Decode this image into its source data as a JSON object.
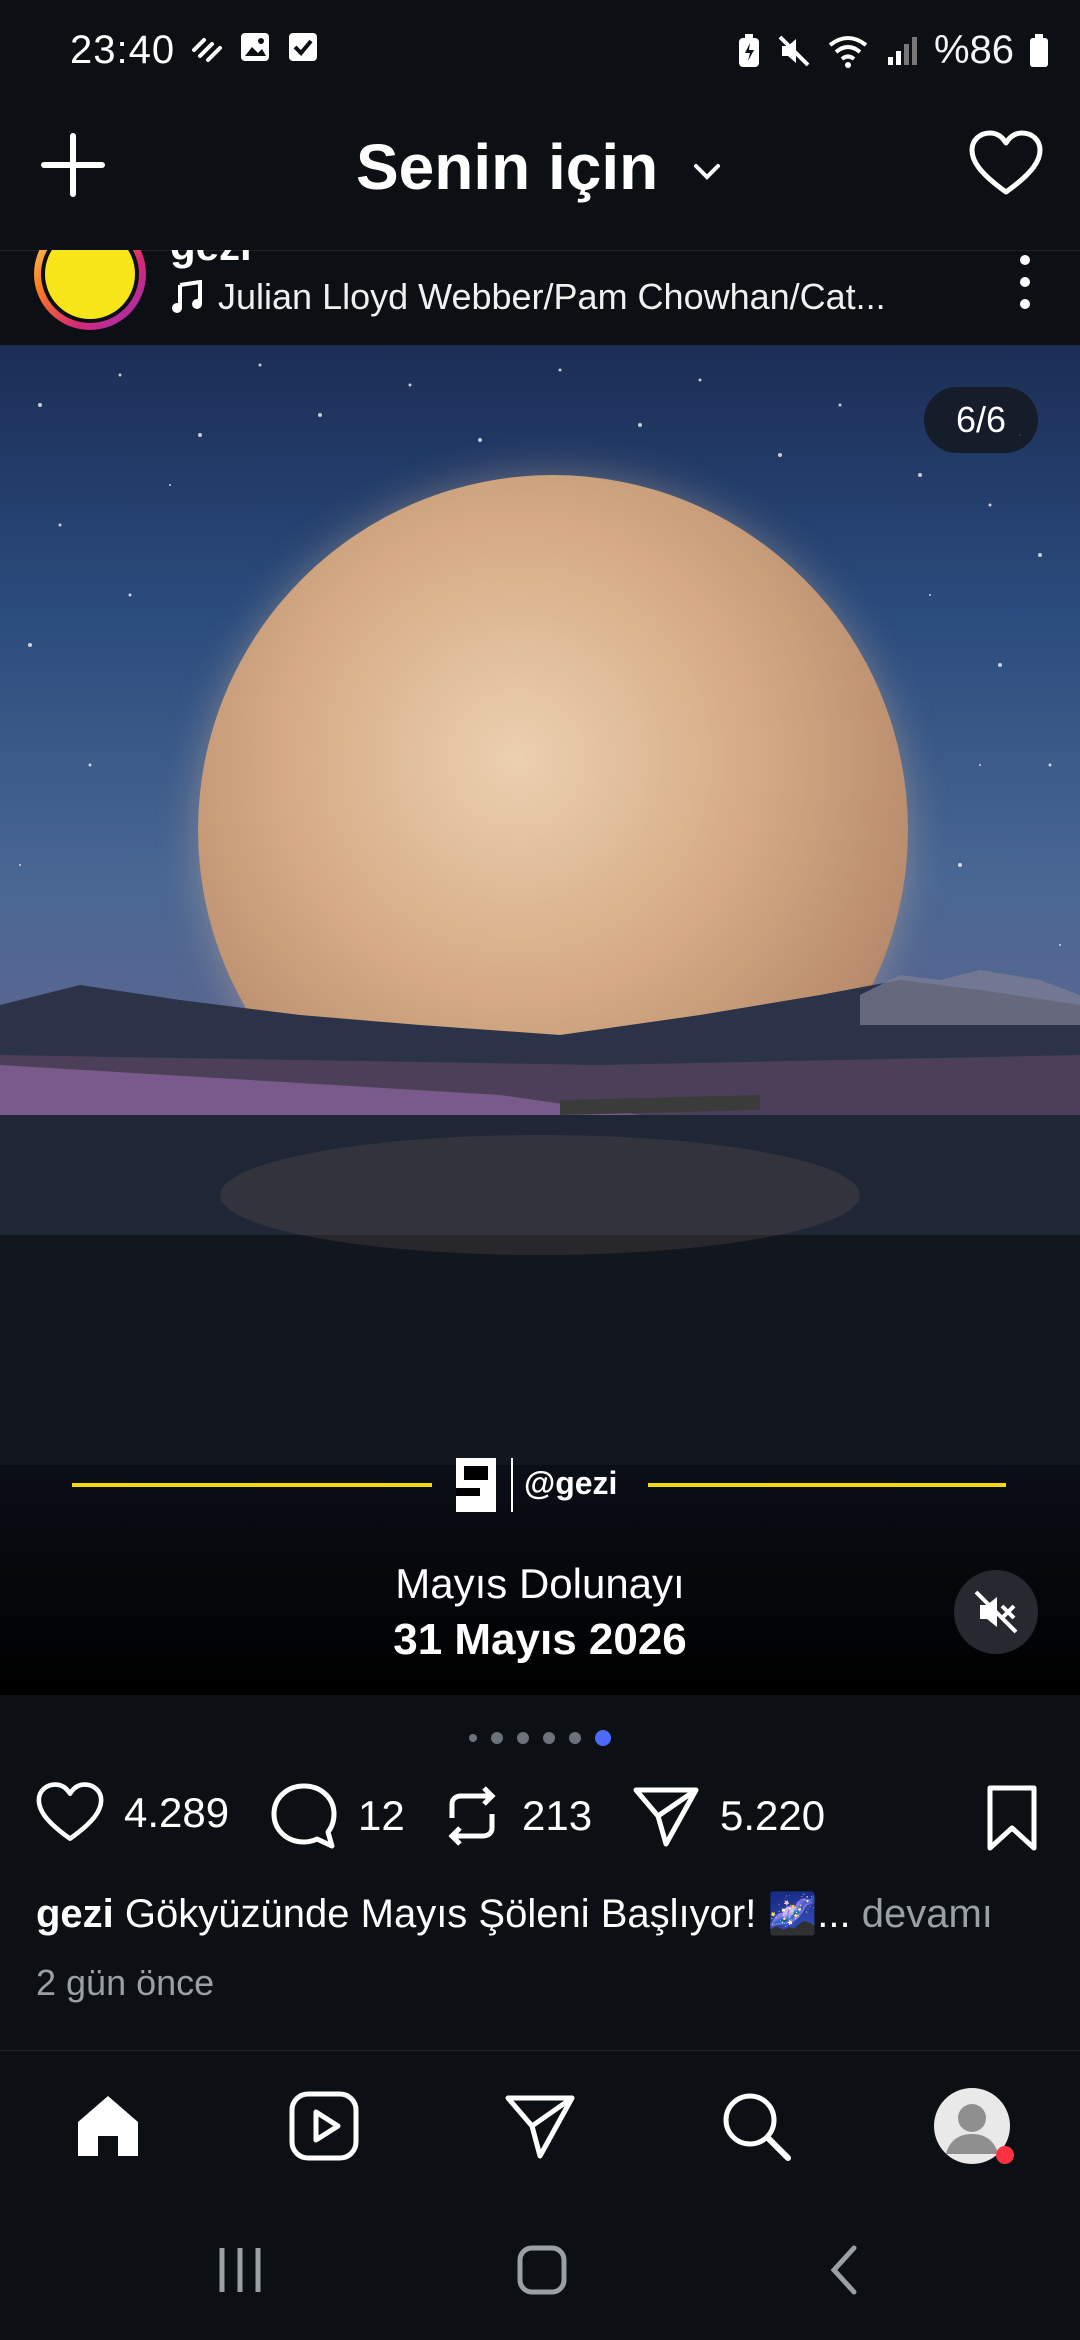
{
  "status_bar": {
    "time": "23:40",
    "battery": "%86",
    "left_icons": [
      "signal-dots-icon",
      "gallery-icon",
      "checkbox-icon"
    ],
    "right_icons": [
      "battery-saver-icon",
      "mute-icon",
      "wifi-icon",
      "cell-signal-icon",
      "battery-icon"
    ]
  },
  "header": {
    "title": "Senin için",
    "icons": [
      "plus-icon",
      "chevron-down-icon",
      "heart-icon"
    ]
  },
  "post": {
    "username": "gezi",
    "verified": true,
    "music": "Julian Lloyd Webber/Pam Chowhan/Cat...",
    "image_counter": "6/6",
    "brand_handle": "@gezi",
    "image_caption_line1": "Mayıs Dolunayı",
    "image_caption_line2": "31 Mayıs 2026",
    "carousel_dots": 6,
    "carousel_active_index": 5,
    "likes": "4.289",
    "comments": "12",
    "reposts": "213",
    "shares": "5.220",
    "caption_text": "Gökyüzünde Mayıs Şöleni Başlıyor! 🌌...",
    "more_label": "devamı",
    "time_ago": "2 gün önce"
  },
  "bottom_nav": {
    "items": [
      "home-icon",
      "reels-icon",
      "send-icon",
      "search-icon",
      "profile-avatar"
    ]
  },
  "colors": {
    "background": "#0c1014",
    "accent_dot": "#4b6bff",
    "notification_dot": "#ff3040",
    "brand_yellow": "#f7e51a"
  }
}
